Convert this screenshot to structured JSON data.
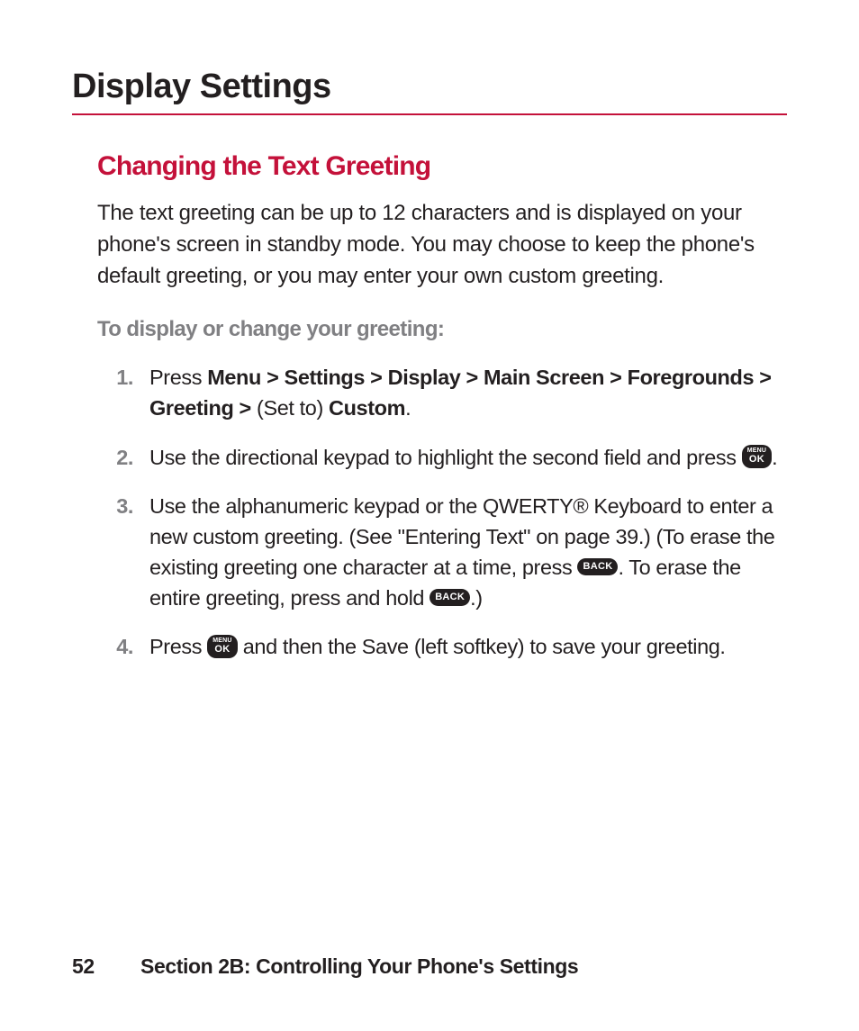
{
  "page_title": "Display Settings",
  "section_heading": "Changing the Text Greeting",
  "intro_paragraph": "The text greeting can be up to 12 characters and is displayed on your phone's screen in standby mode. You may choose to keep the phone's default greeting, or you may enter your own custom greeting.",
  "subheading": "To display or change your greeting:",
  "steps": [
    {
      "number": "1.",
      "parts": {
        "a": "Press ",
        "b_bold": "Menu > Settings > Display > Main Screen > Foregrounds > Greeting > ",
        "c": "(Set to) ",
        "d_bold": "Custom",
        "e": "."
      }
    },
    {
      "number": "2.",
      "parts": {
        "a": "Use the directional keypad to highlight the second field and press ",
        "b_after_key": "."
      }
    },
    {
      "number": "3.",
      "parts": {
        "a": "Use the alphanumeric keypad or the QWERTY® Keyboard to enter a new custom greeting. (See \"Entering Text\" on page 39.) (To erase the existing greeting one character at a time, press ",
        "b": ". To erase the entire greeting, press and hold ",
        "c": ".)"
      }
    },
    {
      "number": "4.",
      "parts": {
        "a": "Press ",
        "b": " and then the Save (left softkey) to save your greeting."
      }
    }
  ],
  "keys": {
    "menu_ok": {
      "line1": "MENU",
      "line2": "OK"
    },
    "back": {
      "line1": "",
      "line2": "BACK"
    }
  },
  "footer": {
    "page_number": "52",
    "section_label": "Section 2B: Controlling Your Phone's Settings"
  }
}
